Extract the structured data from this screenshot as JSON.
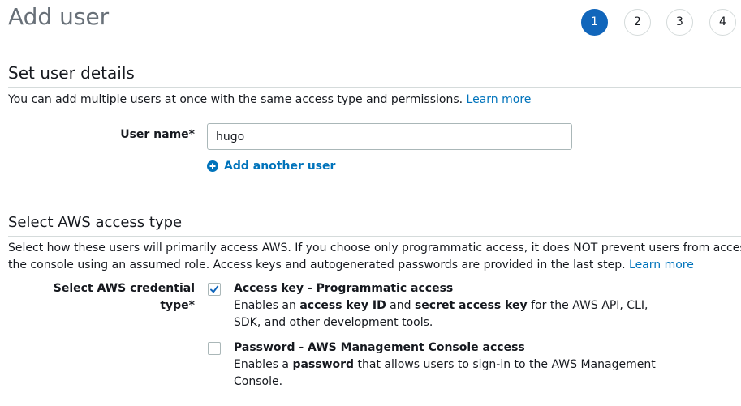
{
  "page": {
    "title": "Add user"
  },
  "steps": [
    {
      "label": "1",
      "active": true
    },
    {
      "label": "2",
      "active": false
    },
    {
      "label": "3",
      "active": false
    },
    {
      "label": "4",
      "active": false
    }
  ],
  "details": {
    "title": "Set user details",
    "description": "You can add multiple users at once with the same access type and permissions.",
    "learn_more": "Learn more",
    "username_label": "User name*",
    "username_value": "hugo",
    "add_another": "Add another user"
  },
  "access": {
    "title": "Select AWS access type",
    "description_line1": "Select how these users will primarily access AWS. If you choose only programmatic access, it does NOT prevent users from accessing",
    "description_line2": "the console using an assumed role. Access keys and autogenerated passwords are provided in the last step.",
    "learn_more": "Learn more",
    "credential_label_line1": "Select AWS credential",
    "credential_label_line2": "type*",
    "options": [
      {
        "title": "Access key - Programmatic access",
        "checked": true,
        "desc_parts": [
          {
            "text": "Enables an ",
            "bold": false
          },
          {
            "text": "access key ID",
            "bold": true
          },
          {
            "text": " and ",
            "bold": false
          },
          {
            "text": "secret access key",
            "bold": true
          },
          {
            "text": " for the AWS API, CLI, SDK, and other development tools.",
            "bold": false
          }
        ]
      },
      {
        "title": "Password - AWS Management Console access",
        "checked": false,
        "desc_parts": [
          {
            "text": "Enables a ",
            "bold": false
          },
          {
            "text": "password",
            "bold": true
          },
          {
            "text": " that allows users to sign-in to the AWS Management Console.",
            "bold": false
          }
        ]
      }
    ]
  },
  "colors": {
    "accent": "#1166bb",
    "link": "#0073bb",
    "divider": "#d5dbdb"
  }
}
